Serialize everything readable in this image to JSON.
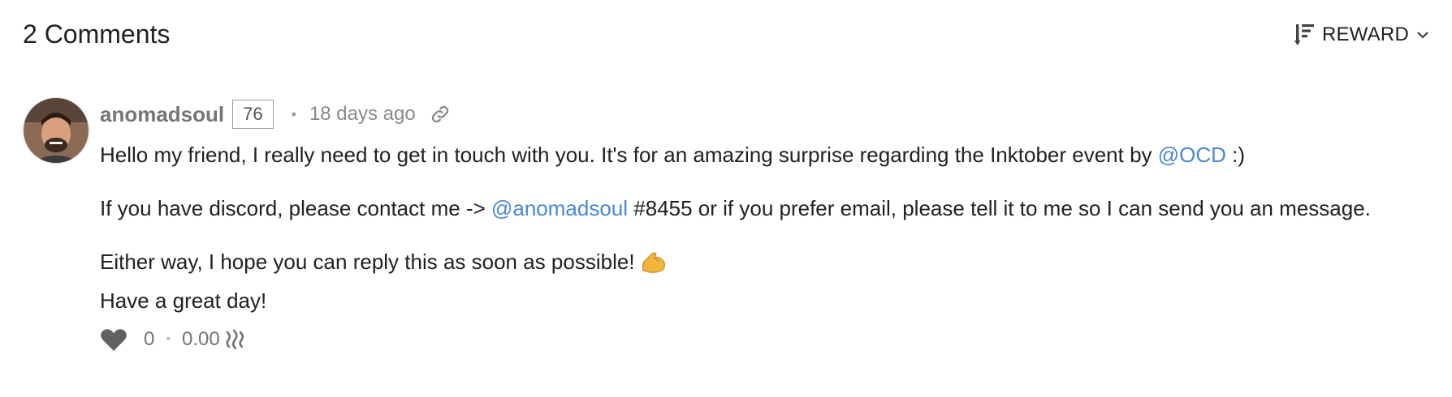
{
  "header": {
    "comments_title": "2 Comments",
    "sort_label": "REWARD",
    "sort_icon": "sort-descending-icon",
    "dropdown_icon": "chevron-down-icon"
  },
  "comment": {
    "avatar_icon": "user-avatar",
    "author": "anomadsoul",
    "reputation": "76",
    "separator": "•",
    "timestamp": "18 days ago",
    "permalink_icon": "link-icon",
    "paragraph1": {
      "before": "Hello my friend, I really need to get in touch with you. It's for an amazing surprise regarding the Inktober event by ",
      "mention": "@OCD",
      "after": " :)"
    },
    "paragraph2": {
      "before": "If you have discord, please contact me -> ",
      "mention": "@anomadsoul",
      "after": " #8455 or if you prefer email, please tell it to me so I can send you an message."
    },
    "paragraph3": {
      "line1": "Either way, I hope you can reply this as soon as possible!",
      "emoji": "flexed-biceps-emoji",
      "line2": "Have a great day!"
    },
    "footer": {
      "like_icon": "heart-icon",
      "votes": "0",
      "separator": "•",
      "payout": "0.00",
      "currency_icon": "steem-icon"
    }
  },
  "colors": {
    "link": "#4a87d6",
    "text": "#212121",
    "muted": "#8a8a8a"
  }
}
